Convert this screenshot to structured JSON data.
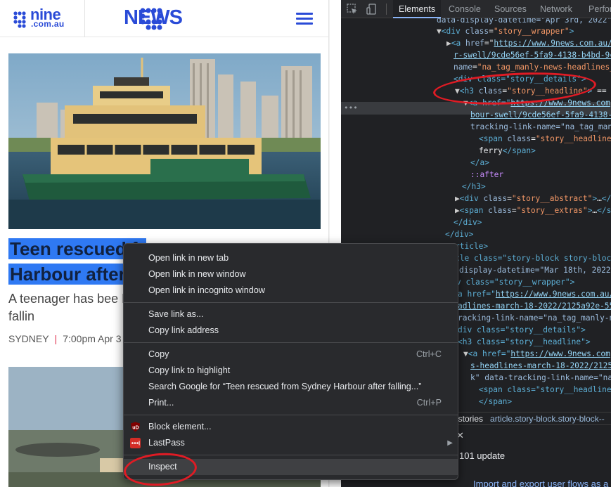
{
  "site": {
    "brand_nine": "nine",
    "brand_nine_sub": ".com.au",
    "brand_news": "NEWS",
    "headline_line1": "Teen rescued fr",
    "headline_line2": "Harbour after",
    "abstract": "A teenager has bee Harbour after fallin",
    "location": "SYDNEY",
    "time": "7:00pm Apr 3"
  },
  "devtools": {
    "tabs": [
      "Elements",
      "Console",
      "Sources",
      "Network",
      "Perfor"
    ],
    "active_tab": "Elements",
    "breadcrumb_1": "_stories",
    "breadcrumb_2": "article.story-block.story-block--",
    "drawer_update": "101 update",
    "drawer_link": "Import and export user flows as a JSON file",
    "code": {
      "l0": "data-display-datetime=\"Apr 3rd, 2022\"",
      "l1_tag": "<div",
      "l1_attr": "class",
      "l1_val": "\"story__wrapper\"",
      "l2_attr": "href",
      "l2_url": "https://www.9news.com.au/",
      "l3_url": "r-swell/9cde56ef-5fa9-4138-b4bd-9c",
      "l4_attr": "name",
      "l4_val": "\"na_tag_manly-news-headlines_",
      "l5": "<div class=\"story__details\">",
      "l6_attr": "class",
      "l6_val": "\"story__headline\"",
      "l7_url": "https://www.9news.com",
      "l8_url": "bour-swell/9cde56ef-5fa9-4138-b",
      "l9": "tracking-link-name=\"na_tag_manl",
      "l10_attr": "class",
      "l10_val": "\"story__headline_",
      "l11": "ferry",
      "l12": "</a>",
      "l13": "::after",
      "l14": "</h3>",
      "l15_attr": "class",
      "l15_val": "\"story__abstract\"",
      "l16_attr": "class",
      "l16_val": "\"story__extras\"",
      "l17": "</div>",
      "l18": "</div>",
      "l19": "rticle>",
      "l20": "cle class=\"story-block story-block",
      "l21": "display-datetime=\"Mar 18th, 2022\"",
      "l22": "v class=\"story__wrapper\">",
      "l23_url": "https://www.9news.com.au/",
      "l24_url": "adlines-march-18-2022/2125a92e-55",
      "l25": "racking-link-name=\"na_tag_manly-n",
      "l26": "div class=\"story__details\">",
      "l27": "<h3 class=\"story__headline\">",
      "l28_url": "https://www.9news.com",
      "l29_url": "s-headlines-march-18-2022/2125a",
      "l30": "k\" data-tracking-link-name=\"na_",
      "l31": "<span class=\"story__headline_",
      "l32": "</span>"
    }
  },
  "context_menu": {
    "items": [
      {
        "label": "Open link in new tab"
      },
      {
        "label": "Open link in new window"
      },
      {
        "label": "Open link in incognito window"
      },
      {
        "label": "Save link as..."
      },
      {
        "label": "Copy link address"
      },
      {
        "label": "Copy",
        "shortcut": "Ctrl+C"
      },
      {
        "label": "Copy link to highlight"
      },
      {
        "label": "Search Google for “Teen rescued from Sydney Harbour after falling...”"
      },
      {
        "label": "Print...",
        "shortcut": "Ctrl+P"
      },
      {
        "label": "Block element..."
      },
      {
        "label": "LastPass"
      },
      {
        "label": "Inspect"
      }
    ]
  },
  "colors": {
    "brand_blue": "#2a4bd7",
    "selection": "#2f79f3",
    "annotation_red": "#e01b24",
    "devtools_bg": "#202124",
    "menu_bg": "#292a2d"
  }
}
